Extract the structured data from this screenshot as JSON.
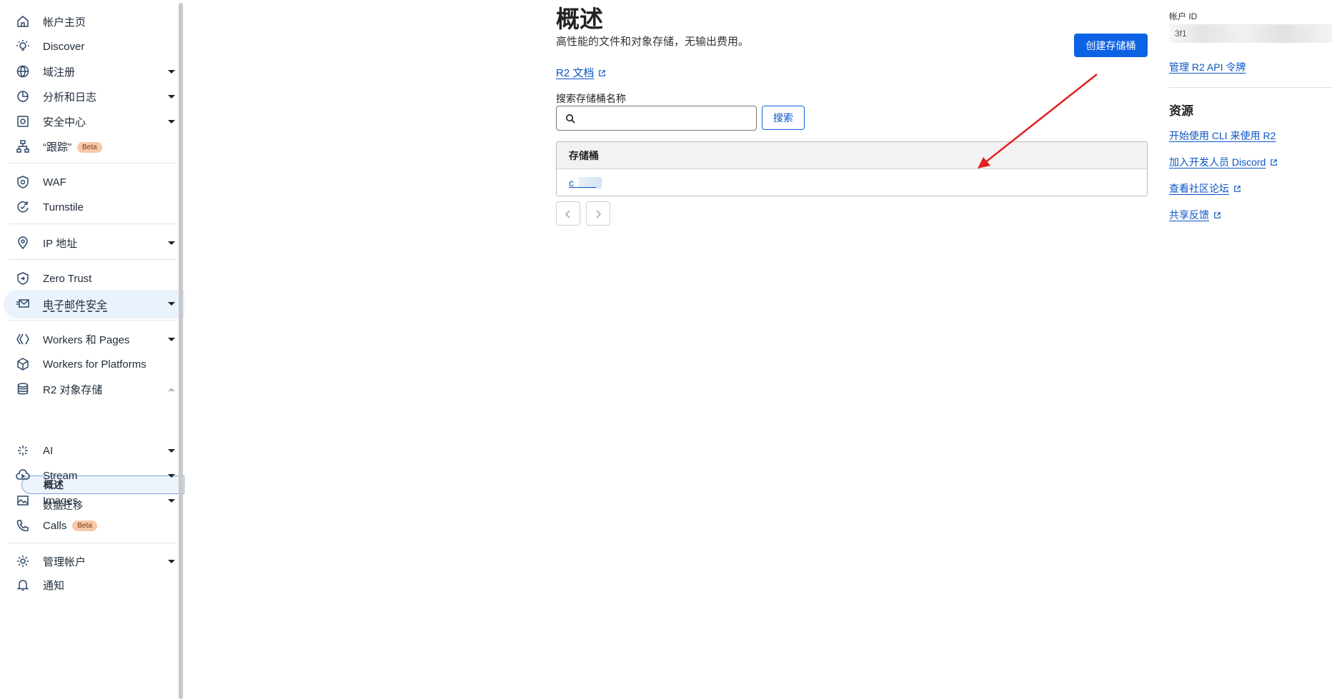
{
  "sidebar": {
    "items": [
      {
        "label": "帐户主页",
        "icon": "home-icon"
      },
      {
        "label": "Discover",
        "icon": "lightbulb-icon"
      },
      {
        "label": "域注册",
        "icon": "globe-icon"
      },
      {
        "label": "分析和日志",
        "icon": "chart-pie-icon"
      },
      {
        "label": "安全中心",
        "icon": "security-center-icon"
      },
      {
        "label": "“跟踪”",
        "icon": "trace-icon",
        "badge": "Beta"
      },
      {
        "label": "WAF",
        "icon": "waf-icon"
      },
      {
        "label": "Turnstile",
        "icon": "turnstile-icon"
      },
      {
        "label": "IP 地址",
        "icon": "map-pin-icon"
      },
      {
        "label": "Zero Trust",
        "icon": "zero-trust-icon"
      },
      {
        "label": "电子邮件安全",
        "icon": "email-security-icon"
      },
      {
        "label": "Workers 和 Pages",
        "icon": "workers-icon"
      },
      {
        "label": "Workers for Platforms",
        "icon": "cube-icon"
      },
      {
        "label": "R2 对象存储",
        "icon": "database-icon"
      },
      {
        "label": "AI",
        "icon": "sparkles-icon"
      },
      {
        "label": "Stream",
        "icon": "stream-cloud-icon"
      },
      {
        "label": "Images",
        "icon": "image-icon"
      },
      {
        "label": "Calls",
        "icon": "phone-icon",
        "badge": "Beta"
      },
      {
        "label": "管理帐户",
        "icon": "gear-icon"
      },
      {
        "label": "通知",
        "icon": "bell-icon"
      }
    ],
    "r2_sub_items": [
      "概述",
      "数据迁移"
    ]
  },
  "main": {
    "title": "概述",
    "subtitle": "高性能的文件和对象存储，无输出费用。",
    "create_button": "创建存储桶",
    "docs_link": "R2 文档",
    "search_label": "搜索存储桶名称",
    "search_placeholder": "",
    "search_button": "搜索",
    "table": {
      "column": "存储桶",
      "rows": [
        "c"
      ]
    }
  },
  "right_panel": {
    "account_id_label": "帐户 ID",
    "account_id_value": "3f1",
    "manage_token_link": "管理 R2 API 令牌",
    "resources_title": "资源",
    "resource_links": [
      "开始使用 CLI 来使用 R2",
      "加入开发人员 Discord",
      "查看社区论坛",
      "共享反馈"
    ]
  },
  "colors": {
    "primary": "#0b62e4",
    "link": "#0b55c4",
    "annotation_arrow": "#e32020",
    "beta_badge": "#f6c7a8"
  }
}
